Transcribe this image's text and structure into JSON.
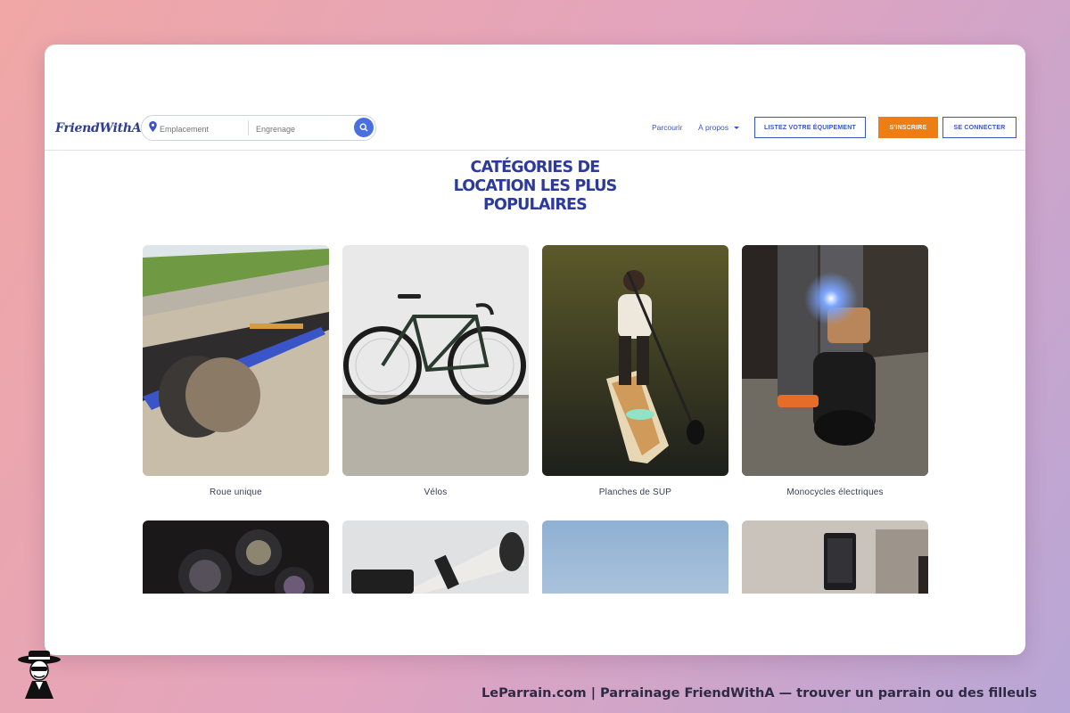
{
  "header": {
    "logo_text": "FriendWithA",
    "logo_dots": "...",
    "search": {
      "location_placeholder": "Emplacement",
      "keyword_placeholder": "Engrenage"
    },
    "nav": {
      "browse": "Parcourir",
      "about": "À propos",
      "list_equipment": "LISTEZ VOTRE ÉQUIPEMENT",
      "signup": "S'INSCRIRE",
      "login": "SE CONNECTER"
    }
  },
  "main": {
    "heading_lines": [
      "CATÉGORIES DE",
      "LOCATION LES PLUS",
      "POPULAIRES"
    ],
    "categories": [
      {
        "label": "Roue unique",
        "icon": "onewheel-board-photo"
      },
      {
        "label": "Vélos",
        "icon": "bicycle-photo"
      },
      {
        "label": "Planches de SUP",
        "icon": "paddleboard-photo"
      },
      {
        "label": "Monocycles électriques",
        "icon": "electric-unicycle-photo"
      }
    ],
    "categories_row2_icons": [
      "camera-lenses-photo",
      "telephoto-lens-photo",
      "sky-photo",
      "camera-monitor-photo"
    ]
  },
  "footer": {
    "caption": "LeParrain.com | Parrainage FriendWithA — trouver un parrain ou des filleuls"
  },
  "colors": {
    "brand_blue": "#2b3a9b",
    "accent_orange": "#ee7d14",
    "link_blue": "#3b55c6"
  }
}
